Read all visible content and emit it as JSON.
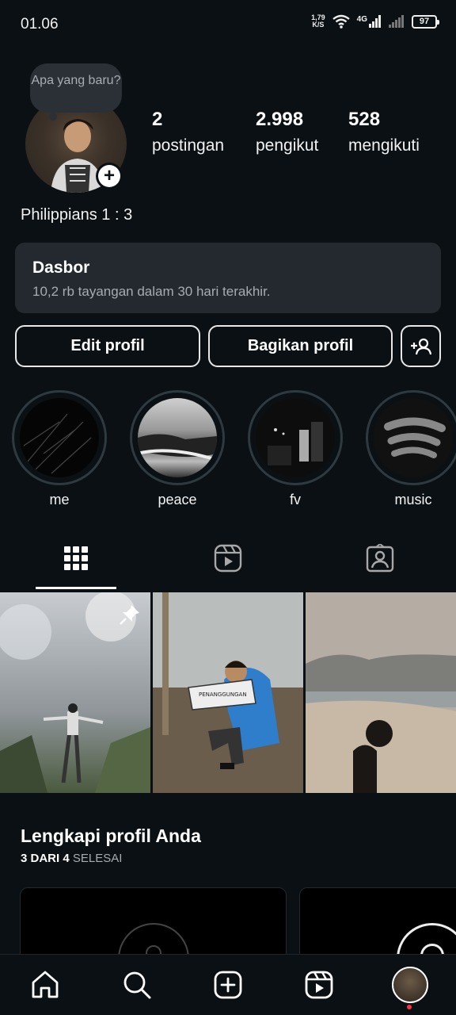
{
  "status_bar": {
    "time": "01.06",
    "net_speed_value": "1,79",
    "net_speed_unit": "K/S",
    "network_type": "4G",
    "battery": "97"
  },
  "profile": {
    "note_text": "Apa yang baru?",
    "stats": [
      {
        "value": "2",
        "label": "postingan"
      },
      {
        "value": "2.998",
        "label": "pengikut"
      },
      {
        "value": "528",
        "label": "mengikuti"
      }
    ],
    "bio": "Philippians 1 : 3"
  },
  "dashboard": {
    "title": "Dasbor",
    "subtitle": "10,2 rb tayangan dalam 30 hari terakhir."
  },
  "actions": {
    "edit_profile": "Edit profil",
    "share_profile": "Bagikan profil"
  },
  "highlights": [
    {
      "label": "me"
    },
    {
      "label": "peace"
    },
    {
      "label": "fv"
    },
    {
      "label": "music"
    }
  ],
  "tabs": [
    "grid-icon",
    "reels-icon",
    "tagged-icon"
  ],
  "posts": [
    {
      "description_icon": "pin-icon"
    },
    {
      "sign_text": "PENANGGUNGAN"
    },
    {}
  ],
  "complete_profile": {
    "title": "Lengkapi profil Anda",
    "progress_count": "3 DARI 4",
    "progress_label": "SELESAI"
  },
  "bottom_nav": [
    "home-icon",
    "search-icon",
    "create-icon",
    "reels-icon",
    "profile-avatar"
  ],
  "colors": {
    "background": "#0b1014",
    "card": "#23292f",
    "notification_dot": "#ff3040"
  }
}
